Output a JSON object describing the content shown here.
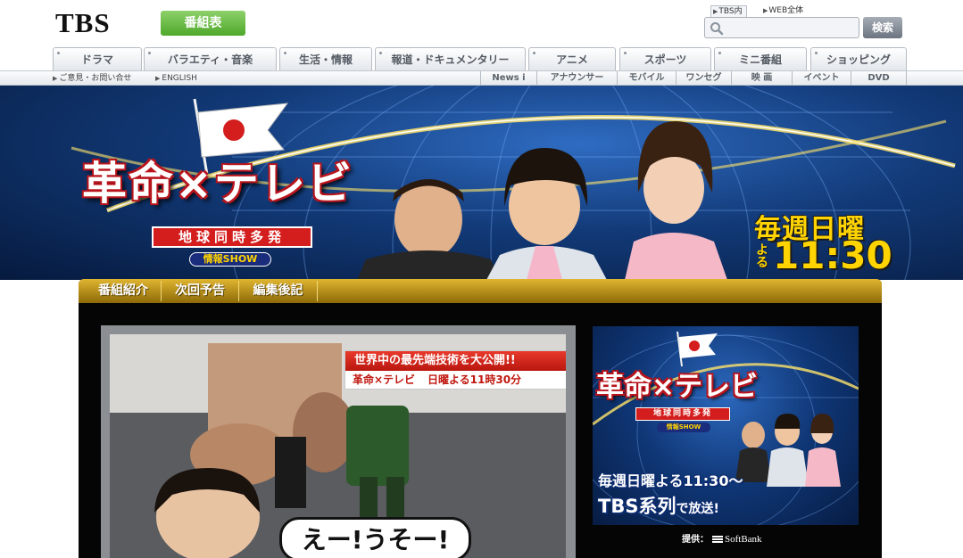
{
  "header": {
    "logo_text": "TBS",
    "schedule_button": "番組表",
    "search_scopes": [
      "TBS内",
      "WEB全体"
    ],
    "search_placeholder": "",
    "search_button": "検索"
  },
  "genre_tabs": [
    "ドラマ",
    "バラエティ・音楽",
    "生活・情報",
    "報道・ドキュメンタリー",
    "アニメ",
    "スポーツ",
    "ミニ番組",
    "ショッピング"
  ],
  "subnav": {
    "left_links": [
      "ご意見・お問い合せ",
      "ENGLISH"
    ],
    "right_links": [
      "News i",
      "アナウンサー",
      "モバイル",
      "ワンセグ",
      "映 画",
      "イベント",
      "DVD"
    ]
  },
  "hero": {
    "title": "革命×テレビ",
    "subtitle": "地球同時多発",
    "show_badge": "情報SHOW",
    "schedule_day": "毎週日曜",
    "schedule_yoru": "よる",
    "schedule_time": "11:30"
  },
  "content_tabs": [
    "番組紹介",
    "次回予告",
    "編集後記"
  ],
  "video": {
    "banner_line1": "世界中の最先端技術を大公開!!",
    "banner_logo": "革命×テレビ",
    "banner_line2": "日曜よる11時30分",
    "caption": "えー!うそー!"
  },
  "promo": {
    "title": "革命×テレビ",
    "subtitle": "地球同時多発",
    "show_badge": "情報SHOW",
    "schedule": "毎週日曜よる11:30〜",
    "network_main": "TBS系列",
    "network_suffix": "で放送!"
  },
  "sponsor": {
    "label": "提供：",
    "name": "SoftBank"
  },
  "colors": {
    "schedule_button": "#4ea82a",
    "tab_bar_gold": "#c8a020",
    "hero_blue": "#123a78",
    "accent_yellow": "#ffd400",
    "title_red": "#b8141c"
  }
}
